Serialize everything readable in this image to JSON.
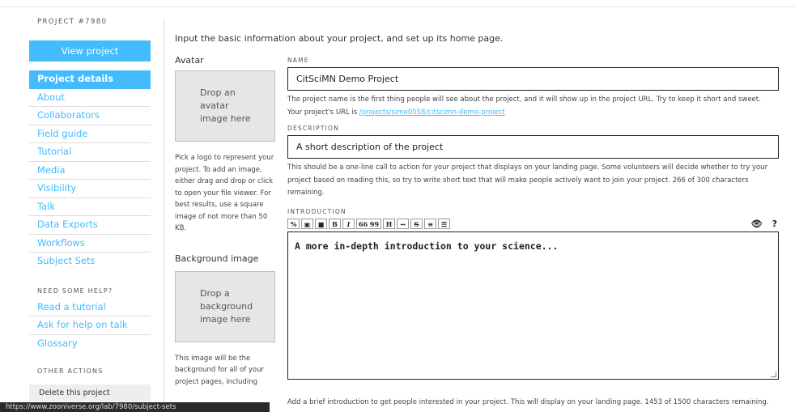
{
  "sidebar": {
    "project_id": "PROJECT #7980",
    "view_project": "View project",
    "nav": [
      {
        "label": "Project details",
        "active": true
      },
      {
        "label": "About"
      },
      {
        "label": "Collaborators"
      },
      {
        "label": "Field guide"
      },
      {
        "label": "Tutorial"
      },
      {
        "label": "Media"
      },
      {
        "label": "Visibility"
      },
      {
        "label": "Talk"
      },
      {
        "label": "Data Exports"
      },
      {
        "label": "Workflows"
      },
      {
        "label": "Subject Sets"
      }
    ],
    "help_label": "NEED SOME HELP?",
    "help_items": [
      "Read a tutorial",
      "Ask for help on talk",
      "Glossary"
    ],
    "other_label": "OTHER ACTIONS",
    "delete_label": "Delete this project"
  },
  "main": {
    "intro": "Input the basic information about your project, and set up its home page.",
    "avatar": {
      "heading": "Avatar",
      "drop_text": [
        "Drop an",
        "avatar",
        "image here"
      ],
      "help": "Pick a logo to represent your project. To add an image, either drag and drop or click to open your file viewer. For best results, use a square image of not more than 50 KB."
    },
    "background": {
      "heading": "Background image",
      "drop_text": [
        "Drop a",
        "background",
        "image here"
      ],
      "help": "This image will be the background for all of your project pages, including"
    },
    "name": {
      "label": "NAME",
      "value": "CitSciMN Demo Project",
      "note": "The project name is the first thing people will see about the project, and it will show up in the project URL. Try to keep it short and sweet.",
      "url_prefix": "Your project's URL is",
      "url": "/projects/sime0058/citscimn-demo-project"
    },
    "description": {
      "label": "DESCRIPTION",
      "value": "A short description of the project",
      "note": "This should be a one-line call to action for your project that displays on your landing page. Some volunteers will decide whether to try your project based on reading this, so try to write short text that will make people actively want to join your project. 266 of 300 characters remaining."
    },
    "introduction": {
      "label": "INTRODUCTION",
      "toolbar": [
        "%",
        "▣",
        "■",
        "B",
        "I",
        "66 99",
        "H",
        "↔",
        "S",
        "≡",
        "☰"
      ],
      "preview_icon": "👁",
      "help_icon": "?",
      "value": "A more in-depth introduction to your science...",
      "note": "Add a brief introduction to get people interested in your project. This will display on your landing page. 1453 of 1500 characters remaining."
    }
  },
  "status_url": "https://www.zooniverse.org/lab/7980/subject-sets"
}
